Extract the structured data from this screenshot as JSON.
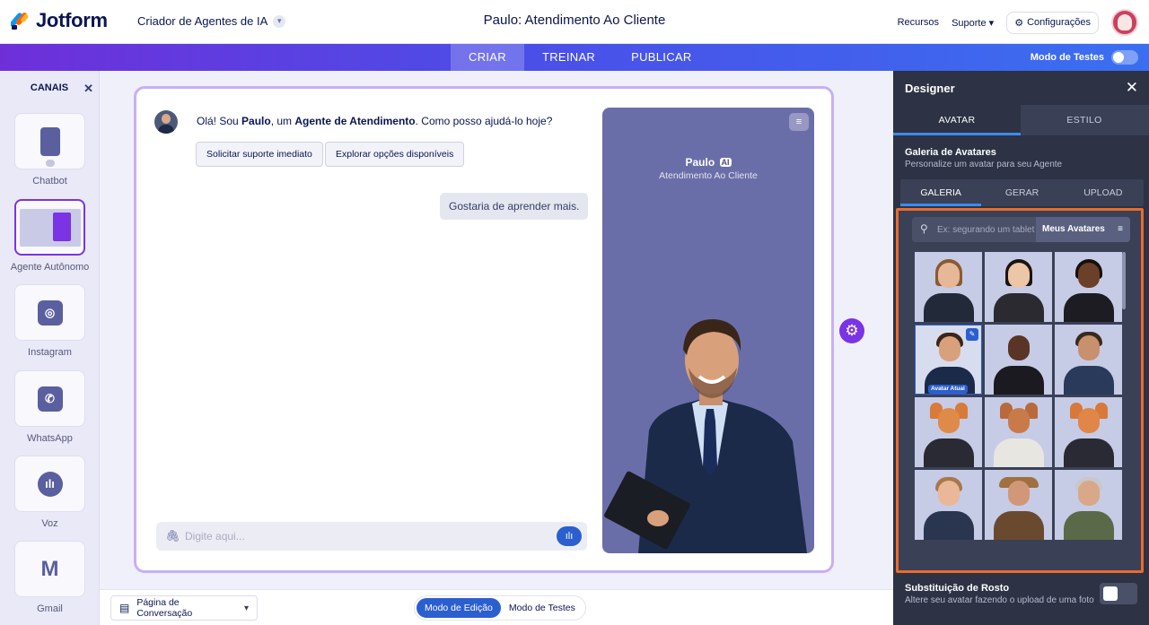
{
  "header": {
    "brand": "Jotform",
    "app_name": "Criador de Agentes de IA",
    "agent_title": "Paulo: Atendimento Ao Cliente",
    "resources": "Recursos",
    "support": "Suporte",
    "settings": "Configurações"
  },
  "nav": {
    "tabs": [
      "CRIAR",
      "TREINAR",
      "PUBLICAR"
    ],
    "active_tab": "CRIAR",
    "test_mode_label": "Modo de Testes"
  },
  "channels": {
    "title": "CANAIS",
    "items": [
      {
        "label": "Chatbot",
        "icon": "chatbot-icon"
      },
      {
        "label": "Agente Autônomo",
        "icon": "agent-icon",
        "selected": true
      },
      {
        "label": "Instagram",
        "icon": "instagram-icon"
      },
      {
        "label": "WhatsApp",
        "icon": "whatsapp-icon"
      },
      {
        "label": "Voz",
        "icon": "voice-icon"
      },
      {
        "label": "Gmail",
        "icon": "gmail-icon"
      }
    ]
  },
  "chat": {
    "greeting_prefix": "Olá! Sou ",
    "agent_name": "Paulo",
    "greeting_mid": ", um ",
    "agent_role": "Agente de Atendimento",
    "greeting_suffix": ". Como posso ajudá-lo hoje?",
    "quick_replies": [
      "Solicitar suporte imediato",
      "Explorar opções disponíveis"
    ],
    "user_message": "Gostaria de aprender mais.",
    "input_placeholder": "Digite aqui..."
  },
  "preview": {
    "name": "Paulo",
    "ai_badge": "AI",
    "role": "Atendimento Ao Cliente"
  },
  "bottom": {
    "page_select": "Página de Conversação",
    "mode_edit": "Modo de Edição",
    "mode_test": "Modo de Testes"
  },
  "designer": {
    "title": "Designer",
    "tabs": [
      "AVATAR",
      "ESTILO"
    ],
    "gallery_title": "Galeria de Avatares",
    "gallery_subtitle": "Personalize um avatar para seu Agente",
    "gallery_tabs": [
      "GALERIA",
      "GERAR",
      "UPLOAD"
    ],
    "search_placeholder": "Ex: segurando um tablet",
    "filter_label": "Meus Avatares",
    "current_avatar_badge": "Avatar Atual",
    "face_swap_title": "Substituição de Rosto",
    "face_swap_desc": "Altere seu avatar fazendo o upload de uma foto"
  },
  "colors": {
    "accent_purple": "#7b33e6",
    "accent_blue": "#2b5fd0",
    "designer_bg": "#2d3244",
    "highlight_orange": "#ea6b2d",
    "preview_bg": "#6a6ea8"
  }
}
